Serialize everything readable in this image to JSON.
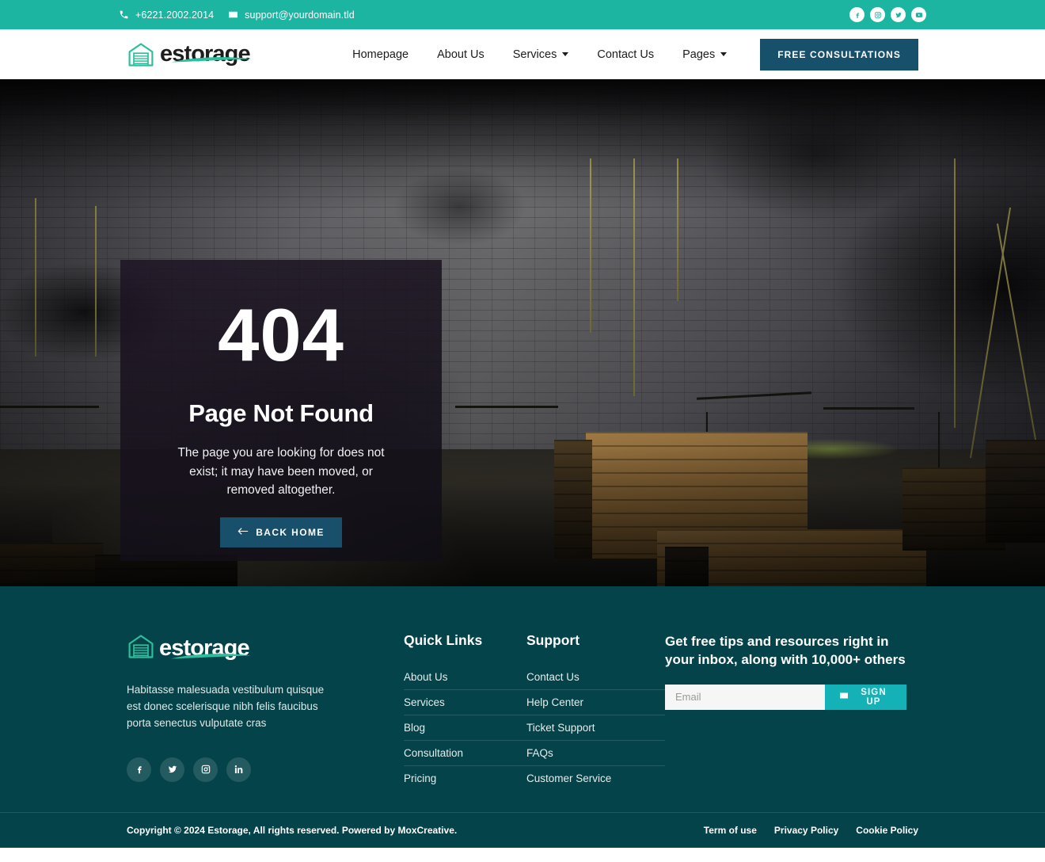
{
  "topbar": {
    "phone": "+6221.2002.2014",
    "email": "support@yourdomain.tld",
    "phone_icon": "phone-icon",
    "email_icon": "envelope-icon",
    "socials": [
      "facebook-icon",
      "instagram-icon",
      "twitter-icon",
      "youtube-icon"
    ],
    "bg_color": "#1bb5a1"
  },
  "header": {
    "brand": "estorage",
    "brand_icon": "warehouse-icon",
    "nav": [
      {
        "label": "Homepage",
        "has_dropdown": false
      },
      {
        "label": "About Us",
        "has_dropdown": false
      },
      {
        "label": "Services",
        "has_dropdown": true
      },
      {
        "label": "Contact Us",
        "has_dropdown": false
      },
      {
        "label": "Pages",
        "has_dropdown": true
      }
    ],
    "cta_label": "FREE CONSULTATIONS",
    "cta_color": "#17506b"
  },
  "hero": {
    "error_code": "404",
    "title": "Page Not Found",
    "description": "The page you are looking for does not exist; it may have been moved, or removed altogether.",
    "back_label": "BACK HOME",
    "back_icon": "arrow-left-icon",
    "background": "dark industrial warehouse with brick wall and wooden crates"
  },
  "footer": {
    "brand": "estorage",
    "brand_icon": "warehouse-icon",
    "description": "Habitasse malesuada vestibulum quisque est donec scelerisque nibh felis faucibus porta senectus vulputate cras",
    "socials": [
      "facebook-icon",
      "twitter-icon",
      "instagram-icon",
      "linkedin-icon"
    ],
    "quick_links": {
      "title": "Quick Links",
      "items": [
        "About Us",
        "Services",
        "Blog",
        "Consultation",
        "Pricing"
      ]
    },
    "support": {
      "title": "Support",
      "items": [
        "Contact Us",
        "Help Center",
        "Ticket Support",
        "FAQs",
        "Customer Service"
      ]
    },
    "newsletter": {
      "title": "Get free tips and resources right in your inbox, along with 10,000+ others",
      "placeholder": "Email",
      "value": "",
      "button_label": "SIGN UP",
      "button_icon": "envelope-icon",
      "button_color": "#14b2b6"
    },
    "bg_color": "#044349"
  },
  "footer_bottom": {
    "copyright": "Copyright © 2024 Estorage, All rights reserved. Powered by MoxCreative.",
    "links": [
      "Term of use",
      "Privacy Policy",
      "Cookie Policy"
    ]
  }
}
